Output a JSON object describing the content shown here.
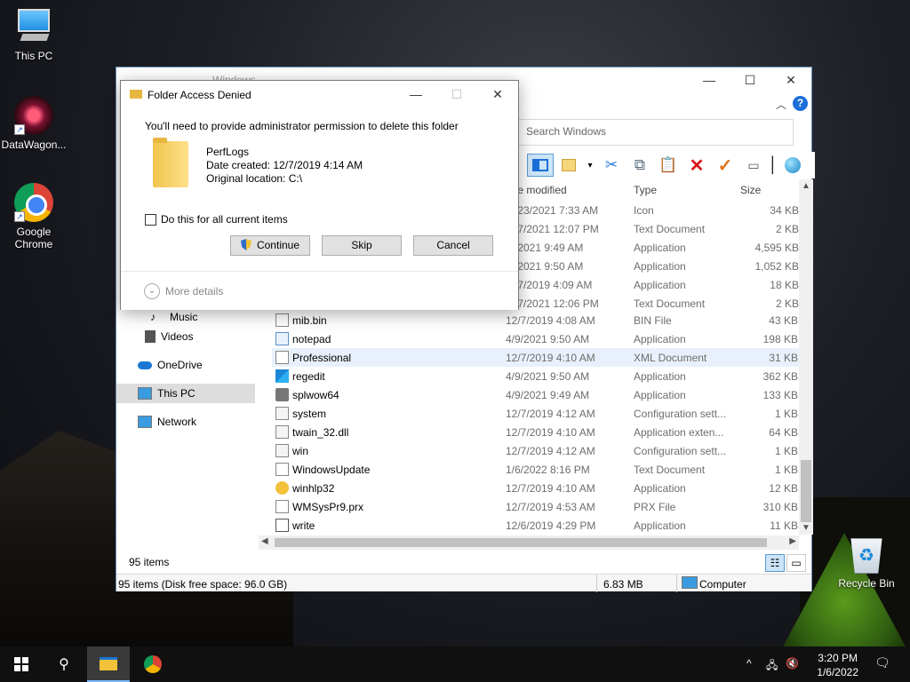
{
  "desktop": {
    "icons": [
      {
        "label": "This PC"
      },
      {
        "label": "DataWagon..."
      },
      {
        "label": "Google\nChrome"
      },
      {
        "label": "Recycle Bin"
      }
    ]
  },
  "explorer": {
    "title": "Windows",
    "search_placeholder": "Search Windows",
    "columns": {
      "date": "te modified",
      "type": "Type",
      "size": "Size"
    },
    "partial_rows": [
      {
        "date": "/23/2021 7:33 AM",
        "type": "Icon",
        "size": "34 KB"
      },
      {
        "date": "/7/2021 12:07 PM",
        "type": "Text Document",
        "size": "2 KB"
      },
      {
        "date": "/2021 9:49 AM",
        "type": "Application",
        "size": "4,595 KB"
      },
      {
        "date": "/2021 9:50 AM",
        "type": "Application",
        "size": "1,052 KB"
      },
      {
        "date": "/7/2019 4:09 AM",
        "type": "Application",
        "size": "18 KB"
      },
      {
        "date": "/7/2021 12:06 PM",
        "type": "Text Document",
        "size": "2 KB"
      }
    ],
    "files": [
      {
        "name": "mib.bin",
        "date": "12/7/2019 4:08 AM",
        "type": "BIN File",
        "size": "43 KB",
        "icon": "file-icon"
      },
      {
        "name": "notepad",
        "date": "4/9/2021 9:50 AM",
        "type": "Application",
        "size": "198 KB",
        "icon": "notepad-icon"
      },
      {
        "name": "Professional",
        "date": "12/7/2019 4:10 AM",
        "type": "XML Document",
        "size": "31 KB",
        "icon": "xml-file-icon"
      },
      {
        "name": "regedit",
        "date": "4/9/2021 9:50 AM",
        "type": "Application",
        "size": "362 KB",
        "icon": "regedit-icon"
      },
      {
        "name": "splwow64",
        "date": "4/9/2021 9:49 AM",
        "type": "Application",
        "size": "133 KB",
        "icon": "printer-icon"
      },
      {
        "name": "system",
        "date": "12/7/2019 4:12 AM",
        "type": "Configuration sett...",
        "size": "1 KB",
        "icon": "config-file-icon"
      },
      {
        "name": "twain_32.dll",
        "date": "12/7/2019 4:10 AM",
        "type": "Application exten...",
        "size": "64 KB",
        "icon": "dll-file-icon"
      },
      {
        "name": "win",
        "date": "12/7/2019 4:12 AM",
        "type": "Configuration sett...",
        "size": "1 KB",
        "icon": "config-file-icon"
      },
      {
        "name": "WindowsUpdate",
        "date": "1/6/2022 8:16 PM",
        "type": "Text Document",
        "size": "1 KB",
        "icon": "text-file-icon"
      },
      {
        "name": "winhlp32",
        "date": "12/7/2019 4:10 AM",
        "type": "Application",
        "size": "12 KB",
        "icon": "help-app-icon"
      },
      {
        "name": "WMSysPr9.prx",
        "date": "12/7/2019 4:53 AM",
        "type": "PRX File",
        "size": "310 KB",
        "icon": "file-icon"
      },
      {
        "name": "write",
        "date": "12/6/2019 4:29 PM",
        "type": "Application",
        "size": "11 KB",
        "icon": "write-app-icon"
      }
    ],
    "nav": [
      {
        "label": "Music"
      },
      {
        "label": "Videos"
      },
      {
        "label": "OneDrive"
      },
      {
        "label": "This PC"
      },
      {
        "label": "Network"
      }
    ],
    "items_count": "95 items",
    "status": {
      "left": "95 items (Disk free space: 96.0 GB)",
      "size": "6.83 MB",
      "location": "Computer"
    }
  },
  "dialog": {
    "title": "Folder Access Denied",
    "message": "You'll need to provide administrator permission to delete this folder",
    "folder_name": "PerfLogs",
    "date_created": "Date created: 12/7/2019 4:14 AM",
    "original_location": "Original location: C:\\",
    "checkbox_label": "Do this for all current items",
    "buttons": {
      "continue": "Continue",
      "skip": "Skip",
      "cancel": "Cancel"
    },
    "more_details": "More details"
  },
  "taskbar": {
    "time": "3:20 PM",
    "date": "1/6/2022"
  }
}
